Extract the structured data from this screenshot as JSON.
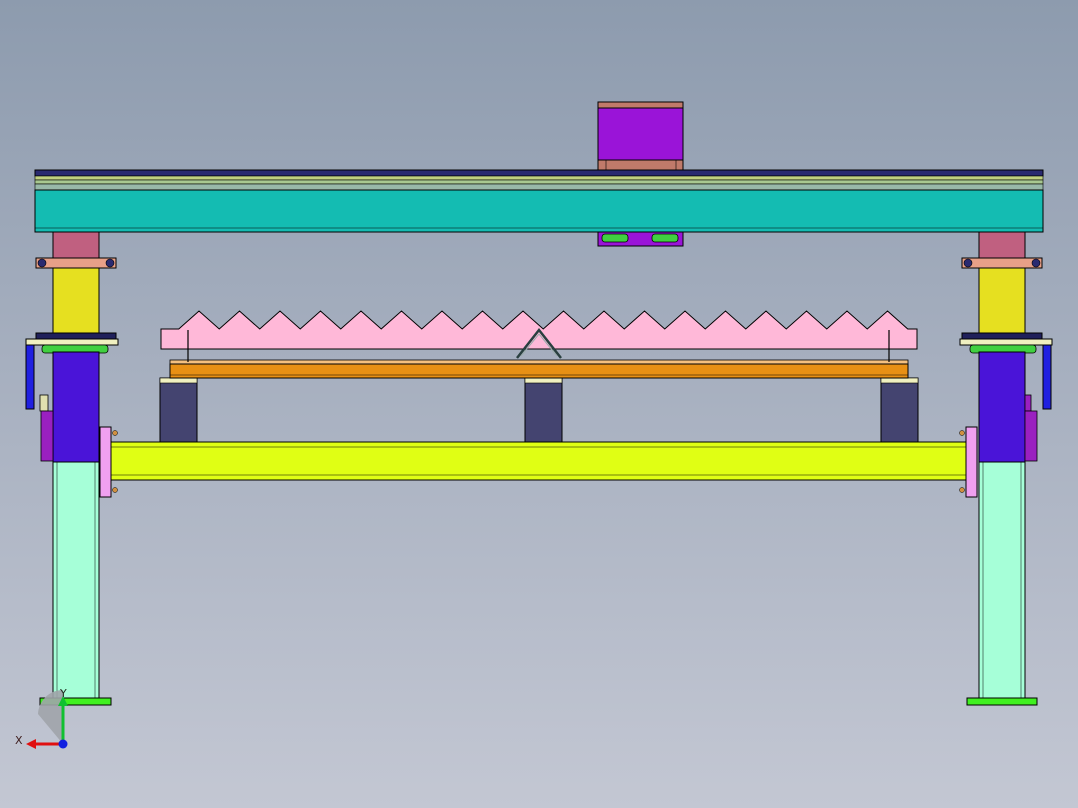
{
  "viewport": {
    "background_top": "#8d9bae",
    "background_bottom": "#c3c7d3"
  },
  "triad": {
    "x_label": "X",
    "y_label": "Y",
    "x_color": "#e01010",
    "y_color": "#10c030",
    "z_color": "#1020e0"
  },
  "palette": {
    "top_beam": "#14bcb2",
    "motor_block": "#9a14d8",
    "motor_mount": "#c07a6a",
    "mount_plate": "#9a14d8",
    "mount_clamps": "#40d040",
    "column_upper": "#c06080",
    "column_middle": "#e6e020",
    "column_lower": "#a6ffd8",
    "column_head": "#4a14d8",
    "side_bar": "#2020e0",
    "flange": "#e8a088",
    "flange_bolts": "#2a2a70",
    "cross_beam": "#e0ff14",
    "end_plate": "#f0a0f0",
    "riser": "#444470",
    "orange_plate": "#e89014",
    "serrated_bar": "#ffb8d8",
    "foot_plate": "#40f020",
    "small_bracket": "#9a20c0"
  }
}
